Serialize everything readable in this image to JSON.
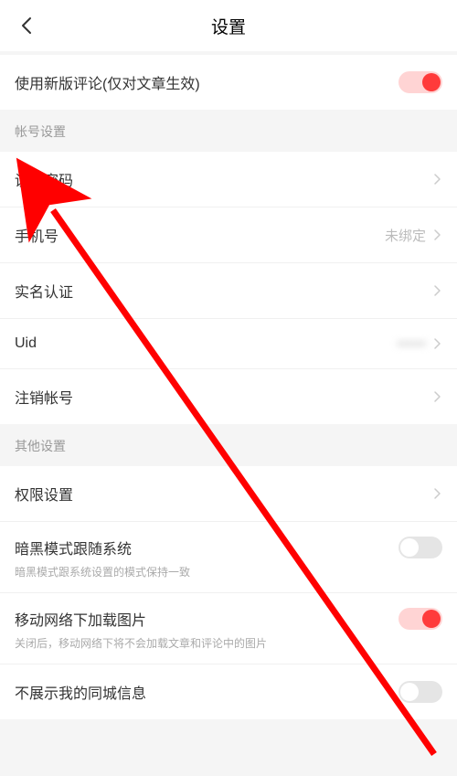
{
  "header": {
    "title": "设置"
  },
  "rows": {
    "new_comments": {
      "label": "使用新版评论(仅对文章生效)",
      "toggle": true
    },
    "section_account": "帐号设置",
    "set_password": {
      "label": "设置密码"
    },
    "phone": {
      "label": "手机号",
      "value": "未绑定"
    },
    "real_name": {
      "label": "实名认证"
    },
    "uid": {
      "label": "Uid",
      "value": "••••••"
    },
    "delete_account": {
      "label": "注销帐号"
    },
    "section_other": "其他设置",
    "permissions": {
      "label": "权限设置"
    },
    "dark_mode": {
      "label": "暗黑模式跟随系统",
      "sub": "暗黑模式跟系统设置的模式保持一致",
      "toggle": false
    },
    "mobile_images": {
      "label": "移动网络下加载图片",
      "sub": "关闭后，移动网络下将不会加载文章和评论中的图片",
      "toggle": true
    },
    "hide_location": {
      "label": "不展示我的同城信息",
      "toggle": false
    }
  }
}
